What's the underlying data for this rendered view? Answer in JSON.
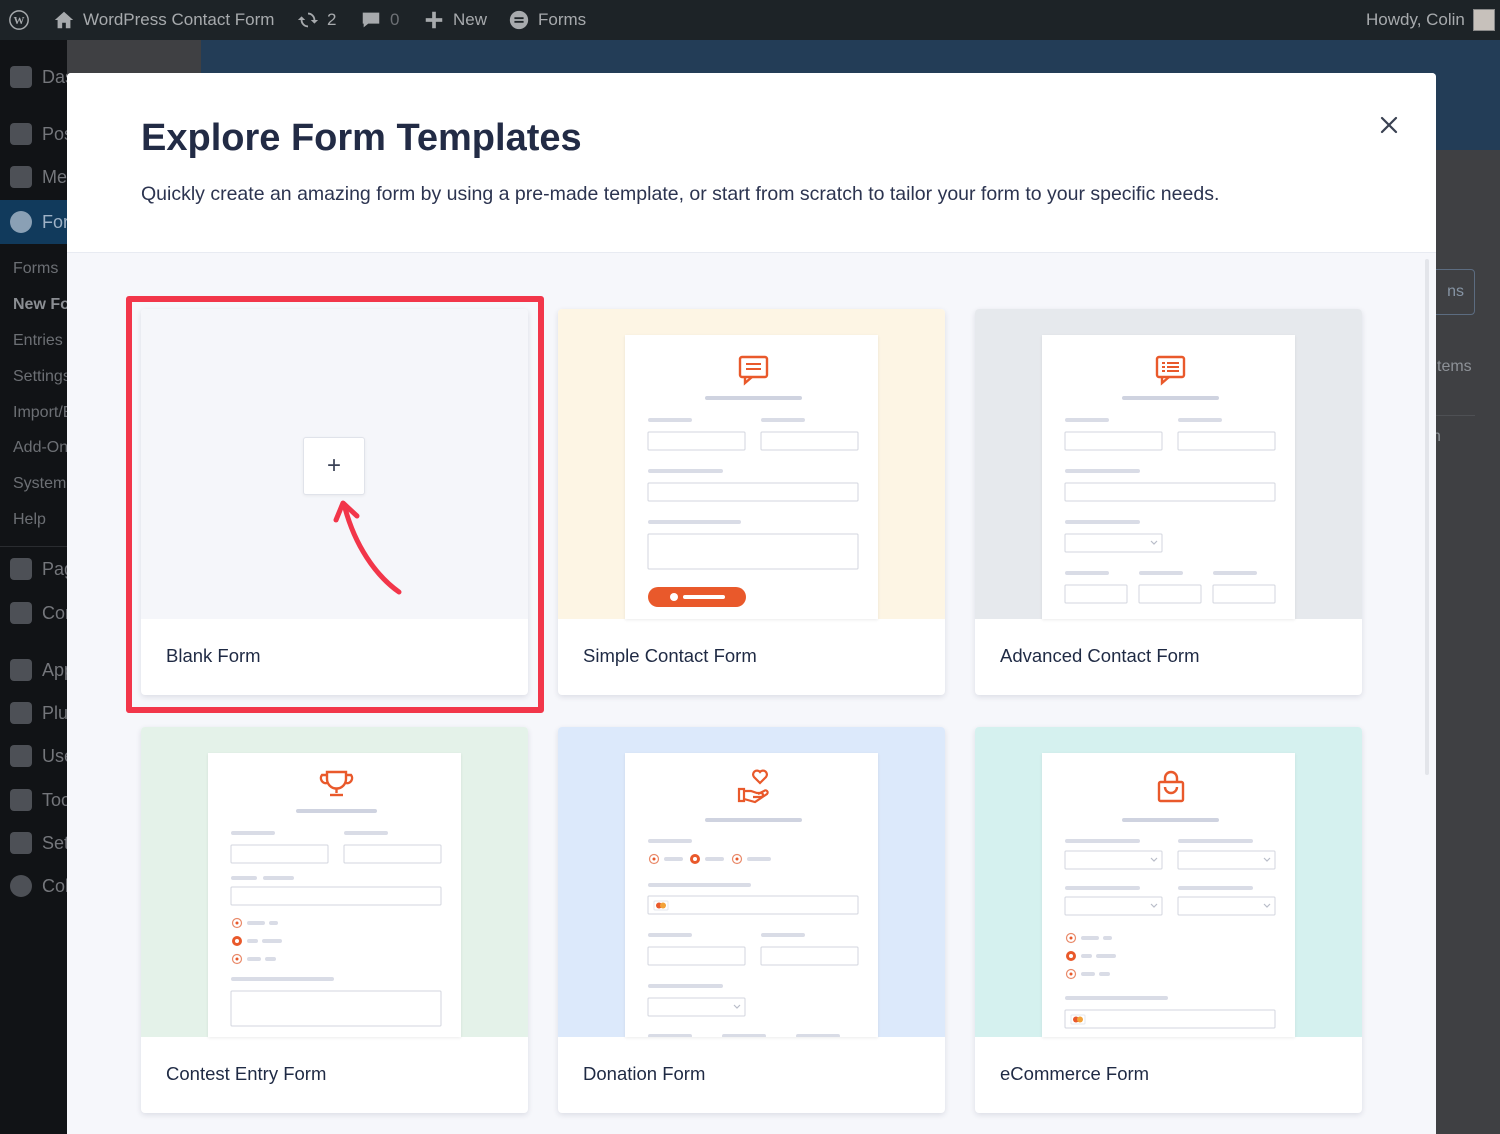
{
  "adminbar": {
    "site_name": "WordPress Contact Form",
    "updates_count": "2",
    "comments_count": "0",
    "new_label": "New",
    "forms_label": "Forms",
    "howdy": "Howdy, Colin"
  },
  "sidebar": {
    "items": [
      {
        "label": "Dashboard",
        "icon": "dashboard-icon"
      },
      {
        "label": "Posts",
        "icon": "pin-icon"
      },
      {
        "label": "Media",
        "icon": "media-icon"
      },
      {
        "label": "Forms",
        "icon": "forms-icon"
      },
      {
        "label": "Pages",
        "icon": "page-icon"
      },
      {
        "label": "Comments",
        "icon": "comment-icon"
      },
      {
        "label": "Appearance",
        "icon": "brush-icon"
      },
      {
        "label": "Plugins",
        "icon": "plugin-icon"
      },
      {
        "label": "Users",
        "icon": "user-icon"
      },
      {
        "label": "Tools",
        "icon": "wrench-icon"
      },
      {
        "label": "Settings",
        "icon": "settings-icon"
      },
      {
        "label": "Collapse menu",
        "icon": "collapse-icon"
      }
    ],
    "subitems": [
      "Forms",
      "New Form",
      "Entries",
      "Settings",
      "Import/Export",
      "Add-Ons",
      "System Status",
      "Help"
    ]
  },
  "background": {
    "button_partial": "ns",
    "items_partial": "tems",
    "col_partial": "n"
  },
  "modal": {
    "title": "Explore Form Templates",
    "subtitle": "Quickly create an amazing form by using a pre-made template, or start from scratch to tailor your form to your specific needs.",
    "close_icon": "close-icon",
    "plus_symbol": "+",
    "templates": [
      {
        "name": "Blank Form",
        "bg": "#f5f6fa"
      },
      {
        "name": "Simple Contact Form",
        "bg": "#fdf5e4"
      },
      {
        "name": "Advanced Contact Form",
        "bg": "#e6e9ed"
      },
      {
        "name": "Contest Entry Form",
        "bg": "#e4f2e9"
      },
      {
        "name": "Donation Form",
        "bg": "#dce9fb"
      },
      {
        "name": "eCommerce Form",
        "bg": "#d5f1ef"
      }
    ]
  },
  "colors": {
    "accent_orange": "#e9592b",
    "highlight_red": "#f2364a",
    "line_gray": "#cfd3e0"
  }
}
